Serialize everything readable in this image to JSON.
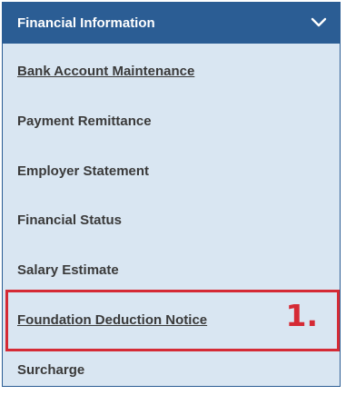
{
  "header": {
    "title": "Financial Information"
  },
  "menu": {
    "items": [
      {
        "label": "Bank Account Maintenance"
      },
      {
        "label": "Payment Remittance"
      },
      {
        "label": "Employer Statement"
      },
      {
        "label": "Financial Status"
      },
      {
        "label": "Salary Estimate"
      },
      {
        "label": "Foundation Deduction Notice"
      },
      {
        "label": "Surcharge"
      }
    ]
  },
  "annotation": {
    "step_label": "1."
  },
  "colors": {
    "header_bg": "#2b5d94",
    "panel_bg": "#d9e6f2",
    "highlight": "#d52a35"
  }
}
